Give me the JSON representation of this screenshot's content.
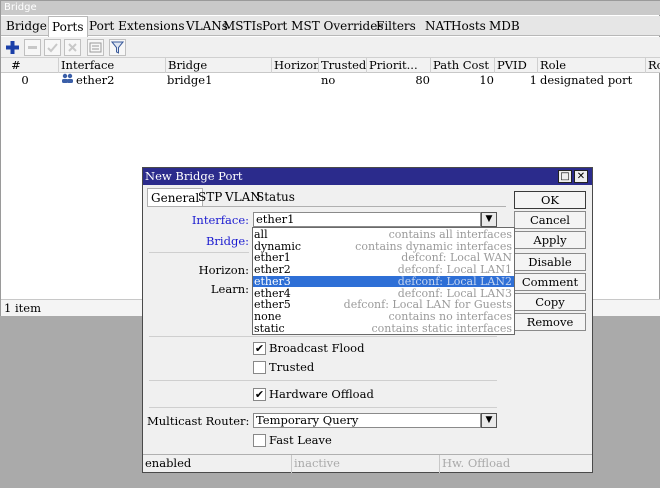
{
  "window": {
    "title": "Bridge"
  },
  "tabs": [
    "Bridge",
    "Ports",
    "Port Extensions",
    "VLANs",
    "MSTIs",
    "Port MST Overrides",
    "Filters",
    "NAT",
    "Hosts",
    "MDB"
  ],
  "active_tab": "Ports",
  "toolbar": {
    "icons": [
      "add-icon",
      "remove-icon",
      "enable-icon",
      "disable-icon",
      "comment-icon",
      "filter-icon"
    ]
  },
  "grid": {
    "columns": [
      "#",
      "Interface",
      "Bridge",
      "Horizon",
      "Trusted",
      "Priorit...",
      "Path Cost",
      "PVID",
      "Role",
      "Roo"
    ],
    "rows": [
      {
        "num": "0",
        "interface": "ether2",
        "bridge": "bridge1",
        "horizon": "",
        "trusted": "no",
        "priority": "80",
        "path_cost": "10",
        "pvid": "1",
        "role": "designated port"
      }
    ]
  },
  "status": {
    "items": "1 item"
  },
  "dialog": {
    "title": "New Bridge Port",
    "tabs": [
      "General",
      "STP",
      "VLAN",
      "Status"
    ],
    "active_tab": "General",
    "labels": {
      "interface": "Interface:",
      "bridge": "Bridge:",
      "horizon": "Horizon:",
      "learn": "Learn:",
      "multicast_router": "Multicast Router:"
    },
    "interface_value": "ether1",
    "multicast_router_value": "Temporary Query",
    "checkboxes": {
      "broadcast_flood": {
        "label": "Broadcast Flood",
        "checked": true
      },
      "trusted": {
        "label": "Trusted",
        "checked": false
      },
      "hardware_offload": {
        "label": "Hardware Offload",
        "checked": true
      },
      "fast_leave": {
        "label": "Fast Leave",
        "checked": false
      }
    },
    "buttons": [
      "OK",
      "Cancel",
      "Apply",
      "Disable",
      "Comment",
      "Copy",
      "Remove"
    ],
    "status": {
      "state": "enabled",
      "inactive": "inactive",
      "hw_offload": "Hw. Offload"
    },
    "dropdown": {
      "selected": "ether3",
      "options": [
        {
          "name": "all",
          "comment": "contains all interfaces"
        },
        {
          "name": "dynamic",
          "comment": "contains dynamic interfaces"
        },
        {
          "name": "ether1",
          "comment": "defconf: Local WAN"
        },
        {
          "name": "ether2",
          "comment": "defconf: Local LAN1"
        },
        {
          "name": "ether3",
          "comment": "defconf: Local LAN2"
        },
        {
          "name": "ether4",
          "comment": "defconf: Local LAN3"
        },
        {
          "name": "ether5",
          "comment": "defconf: Local LAN for Guests"
        },
        {
          "name": "none",
          "comment": "contains no interfaces"
        },
        {
          "name": "static",
          "comment": "contains static interfaces"
        }
      ]
    }
  },
  "colors": {
    "dialog_title_bg": "#2b2b8c",
    "selection": "#2e6fd6",
    "label_blue": "#1b1bd0",
    "add_icon": "#1a3fa8"
  }
}
